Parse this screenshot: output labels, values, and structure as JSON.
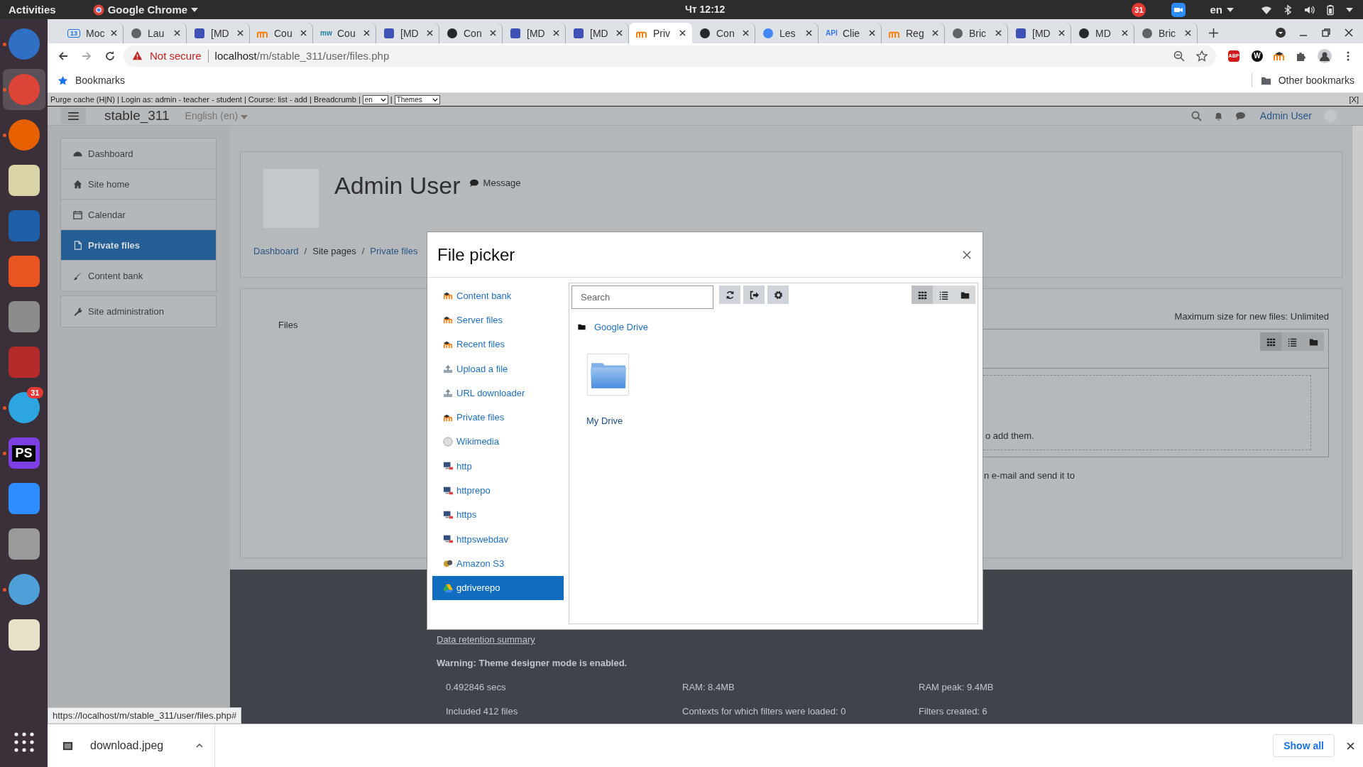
{
  "top_bar": {
    "activities": "Activities",
    "app_name": "Google Chrome",
    "clock": "Чт 12:12",
    "calendar_badge": "31",
    "keyboard_layout": "en"
  },
  "dock": [
    {
      "kind": "mail",
      "running": true,
      "selected": false
    },
    {
      "kind": "chrome",
      "running": true,
      "selected": true
    },
    {
      "kind": "firefox",
      "running": true,
      "selected": false
    },
    {
      "kind": "speaker",
      "running": false,
      "selected": false
    },
    {
      "kind": "writer",
      "running": false,
      "selected": false
    },
    {
      "kind": "store",
      "running": false,
      "selected": false
    },
    {
      "kind": "tools",
      "running": false,
      "selected": false
    },
    {
      "kind": "terminal",
      "running": false,
      "selected": false
    },
    {
      "kind": "telegram",
      "running": true,
      "selected": false,
      "badge": "31"
    },
    {
      "kind": "ide",
      "running": true,
      "selected": false,
      "label": "PS"
    },
    {
      "kind": "video",
      "running": false,
      "selected": false
    },
    {
      "kind": "archive",
      "running": false,
      "selected": false
    },
    {
      "kind": "spiral",
      "running": true,
      "selected": false
    },
    {
      "kind": "editor",
      "running": false,
      "selected": false
    }
  ],
  "tabs": [
    {
      "title": "Moc",
      "selected": false,
      "kind": "calendar",
      "icon_text": "13"
    },
    {
      "title": "Lau",
      "selected": false,
      "kind": "globe"
    },
    {
      "title": "[MD",
      "selected": false,
      "kind": "tracker"
    },
    {
      "title": "Cou",
      "selected": false,
      "kind": "moodle"
    },
    {
      "title": "Cou",
      "selected": false,
      "kind": "wiki",
      "icon_text": "mw"
    },
    {
      "title": "[MD",
      "selected": false,
      "kind": "tracker"
    },
    {
      "title": "Con",
      "selected": false,
      "kind": "github"
    },
    {
      "title": "[MD",
      "selected": false,
      "kind": "tracker"
    },
    {
      "title": "[MD",
      "selected": false,
      "kind": "tracker"
    },
    {
      "title": "Priv",
      "selected": true,
      "kind": "moodle"
    },
    {
      "title": "Con",
      "selected": false,
      "kind": "github"
    },
    {
      "title": "Les",
      "selected": false,
      "kind": "google"
    },
    {
      "title": "Clie",
      "selected": false,
      "kind": "api",
      "icon_text": "API"
    },
    {
      "title": "Reg",
      "selected": false,
      "kind": "moodle"
    },
    {
      "title": "Bric",
      "selected": false,
      "kind": "globe"
    },
    {
      "title": "[MD",
      "selected": false,
      "kind": "tracker"
    },
    {
      "title": "MD",
      "selected": false,
      "kind": "github"
    },
    {
      "title": "Bric",
      "selected": false,
      "kind": "globe"
    }
  ],
  "browser": {
    "security": "Not secure",
    "url_host": "localhost",
    "url_path": "/m/stable_311/user/files.php",
    "bookmarks": "Bookmarks",
    "other_bookmarks": "Other bookmarks",
    "extensions": [
      {
        "kind": "blocker",
        "label": "ABP"
      },
      {
        "kind": "letter",
        "label": "W"
      },
      {
        "kind": "moodle"
      },
      {
        "kind": "puzzle"
      }
    ]
  },
  "dev_bar": {
    "text": "Purge cache (H|N) | Login as: admin - teacher - student | Course: list - add | Breadcrumb |",
    "language": "en",
    "separator": "|",
    "theme": "Themes",
    "close": "[X]"
  },
  "navbar": {
    "site_name": "stable_311",
    "language": "English (en)",
    "user_name": "Admin User"
  },
  "nav_blocks": [
    [
      {
        "label": "Dashboard",
        "kind": "gauge",
        "selected": false
      },
      {
        "label": "Site home",
        "kind": "home",
        "selected": false
      },
      {
        "label": "Calendar",
        "kind": "calendar",
        "selected": false
      },
      {
        "label": "Private files",
        "kind": "file",
        "selected": true
      },
      {
        "label": "Content bank",
        "kind": "brush",
        "selected": false
      }
    ],
    [
      {
        "label": "Site administration",
        "kind": "wrench",
        "selected": false
      }
    ]
  ],
  "profile": {
    "name": "Admin User",
    "message": "Message",
    "separator": "/",
    "breadcrumb": [
      {
        "label": "Dashboard",
        "link": true
      },
      {
        "label": "Site pages",
        "link": false
      },
      {
        "label": "Private files",
        "link": true
      }
    ]
  },
  "files": {
    "label": "Files",
    "max_size": "Maximum size for new files: Unlimited",
    "views": [
      {
        "kind": "grid",
        "selected": true
      },
      {
        "kind": "list",
        "selected": false
      },
      {
        "kind": "tree",
        "selected": false
      }
    ],
    "drop_hint": "o add them.",
    "note": "n e-mail and send it to"
  },
  "footer": {
    "data_retention": "Data retention summary",
    "warning": "Warning: Theme designer mode is enabled.",
    "stats": [
      [
        "0.492846 secs",
        "RAM: 8.4MB",
        "RAM peak: 9.4MB"
      ],
      [
        "Included 412 files",
        "Contexts for which filters were loaded: 0",
        "Filters created: 6"
      ]
    ]
  },
  "status_url": "https://localhost/m/stable_311/user/files.php#",
  "downloads": {
    "file": "download.jpeg",
    "show_all": "Show all"
  },
  "file_picker": {
    "title": "File picker",
    "repositories": [
      {
        "label": "Content bank",
        "kind": "moodle",
        "selected": false
      },
      {
        "label": "Server files",
        "kind": "moodle",
        "selected": false
      },
      {
        "label": "Recent files",
        "kind": "moodle",
        "selected": false
      },
      {
        "label": "Upload a file",
        "kind": "upload",
        "selected": false
      },
      {
        "label": "URL downloader",
        "kind": "upload",
        "selected": false
      },
      {
        "label": "Private files",
        "kind": "moodle",
        "selected": false
      },
      {
        "label": "Wikimedia",
        "kind": "wiki",
        "selected": false
      },
      {
        "label": "http",
        "kind": "server",
        "selected": false
      },
      {
        "label": "httprepo",
        "kind": "server",
        "selected": false
      },
      {
        "label": "https",
        "kind": "server",
        "selected": false
      },
      {
        "label": "httpswebdav",
        "kind": "server",
        "selected": false
      },
      {
        "label": "Amazon S3",
        "kind": "cloud",
        "selected": false
      },
      {
        "label": "gdriverepo",
        "kind": "drive",
        "selected": true
      }
    ],
    "search": {
      "placeholder": "Search"
    },
    "views": [
      {
        "kind": "grid",
        "selected": true
      },
      {
        "kind": "list",
        "selected": false
      },
      {
        "kind": "tree",
        "selected": false
      }
    ],
    "path": "Google Drive",
    "items": [
      {
        "name": "My Drive",
        "kind": "folder"
      }
    ]
  }
}
